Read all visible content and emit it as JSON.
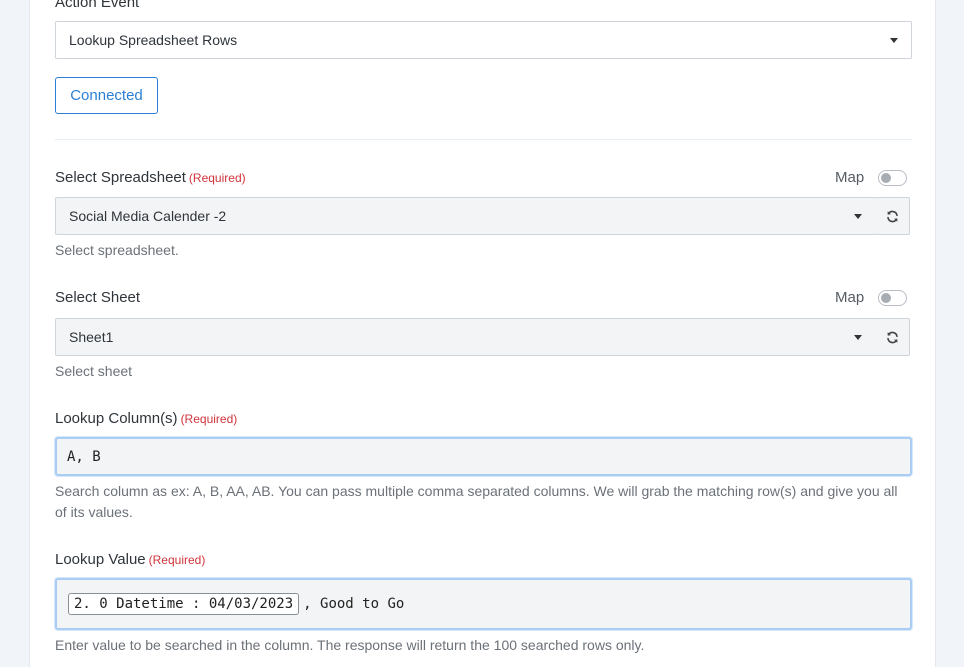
{
  "action_event": {
    "label": "Action Event",
    "value": "Lookup Spreadsheet Rows"
  },
  "connected_button": "Connected",
  "select_spreadsheet": {
    "label": "Select Spreadsheet",
    "required": "(Required)",
    "map_label": "Map",
    "value": "Social Media Calender -2",
    "help": "Select spreadsheet."
  },
  "select_sheet": {
    "label": "Select Sheet",
    "map_label": "Map",
    "value": "Sheet1",
    "help": "Select sheet"
  },
  "lookup_columns": {
    "label": "Lookup Column(s)",
    "required": "(Required)",
    "value": "A, B",
    "help": "Search column as ex: A, B, AA, AB. You can pass multiple comma separated columns. We will grab the matching row(s) and give you all of its values."
  },
  "lookup_value": {
    "label": "Lookup Value",
    "required": "(Required)",
    "chip": "2. 0 Datetime : 04/03/2023",
    "suffix": ", Good to Go",
    "help": "Enter value to be searched in the column. The response will return the 100 searched rows only."
  },
  "icons": {
    "caret": "caret-down-icon",
    "refresh": "refresh-icon"
  },
  "colors": {
    "accent": "#2b7fd2",
    "required": "#d0343a",
    "focus_border": "#a9cdf3"
  }
}
